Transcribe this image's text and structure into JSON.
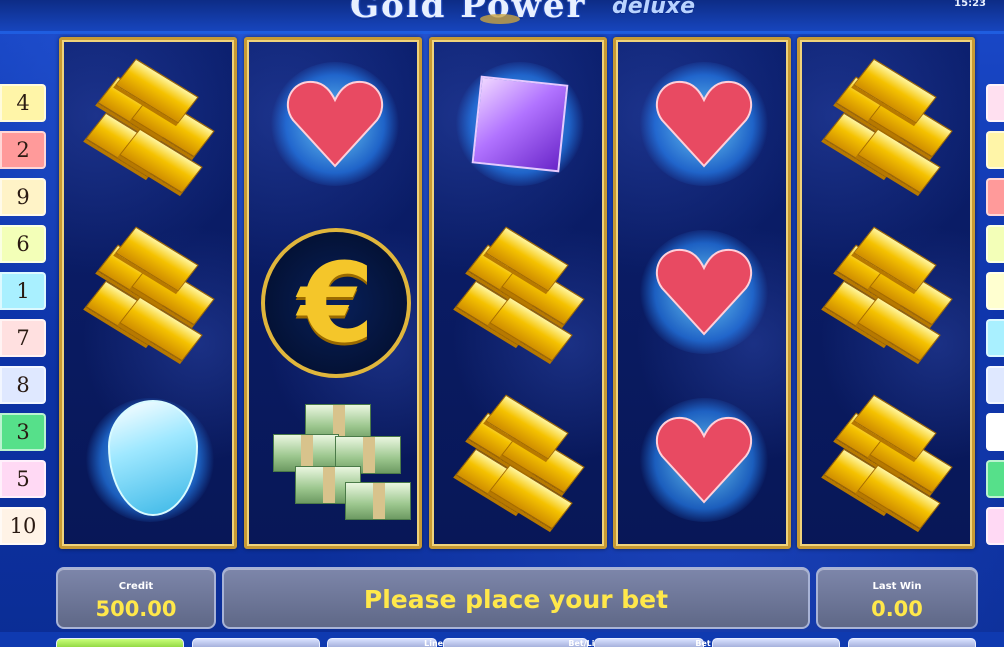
{
  "header": {
    "logo_text": "Gold Power",
    "logo_sub": "deluxe",
    "clock": "15:23"
  },
  "paylines_left": [
    {
      "number": "4",
      "color": "#fff5a8"
    },
    {
      "number": "2",
      "color": "#ff9a9a"
    },
    {
      "number": "9",
      "color": "#fff3c7"
    },
    {
      "number": "6",
      "color": "#f3ffb8"
    },
    {
      "number": "1",
      "color": "#a9f0ff"
    },
    {
      "number": "7",
      "color": "#ffe0e0"
    },
    {
      "number": "8",
      "color": "#dfe8ff"
    },
    {
      "number": "3",
      "color": "#56e08a"
    },
    {
      "number": "5",
      "color": "#ffd9f4"
    },
    {
      "number": "10",
      "color": "#fff3e6"
    }
  ],
  "paylines_right_colors": [
    "#ffe0f0",
    "#fff5a8",
    "#ff9a9a",
    "#f3ffb8",
    "#ffffd0",
    "#a9f0ff",
    "#dfe8ff",
    "#ffffff",
    "#56e08a",
    "#ffd9f4"
  ],
  "reels": [
    [
      "gold-bars",
      "gold-bars",
      "blue-diamond"
    ],
    [
      "red-heart",
      "euro-coin",
      "cash-stack"
    ],
    [
      "purple-gem",
      "gold-bars",
      "gold-bars"
    ],
    [
      "red-heart",
      "red-heart",
      "red-heart"
    ],
    [
      "gold-bars",
      "gold-bars",
      "gold-bars"
    ]
  ],
  "panel": {
    "credit_label": "Credit",
    "credit_value": "500.00",
    "message": "Please place your bet",
    "lastwin_label": "Last Win",
    "lastwin_value": "0.00"
  },
  "buttons": {
    "lines_label": "Lines",
    "betline_label": "Bet/Line",
    "bet_label": "Bet"
  }
}
